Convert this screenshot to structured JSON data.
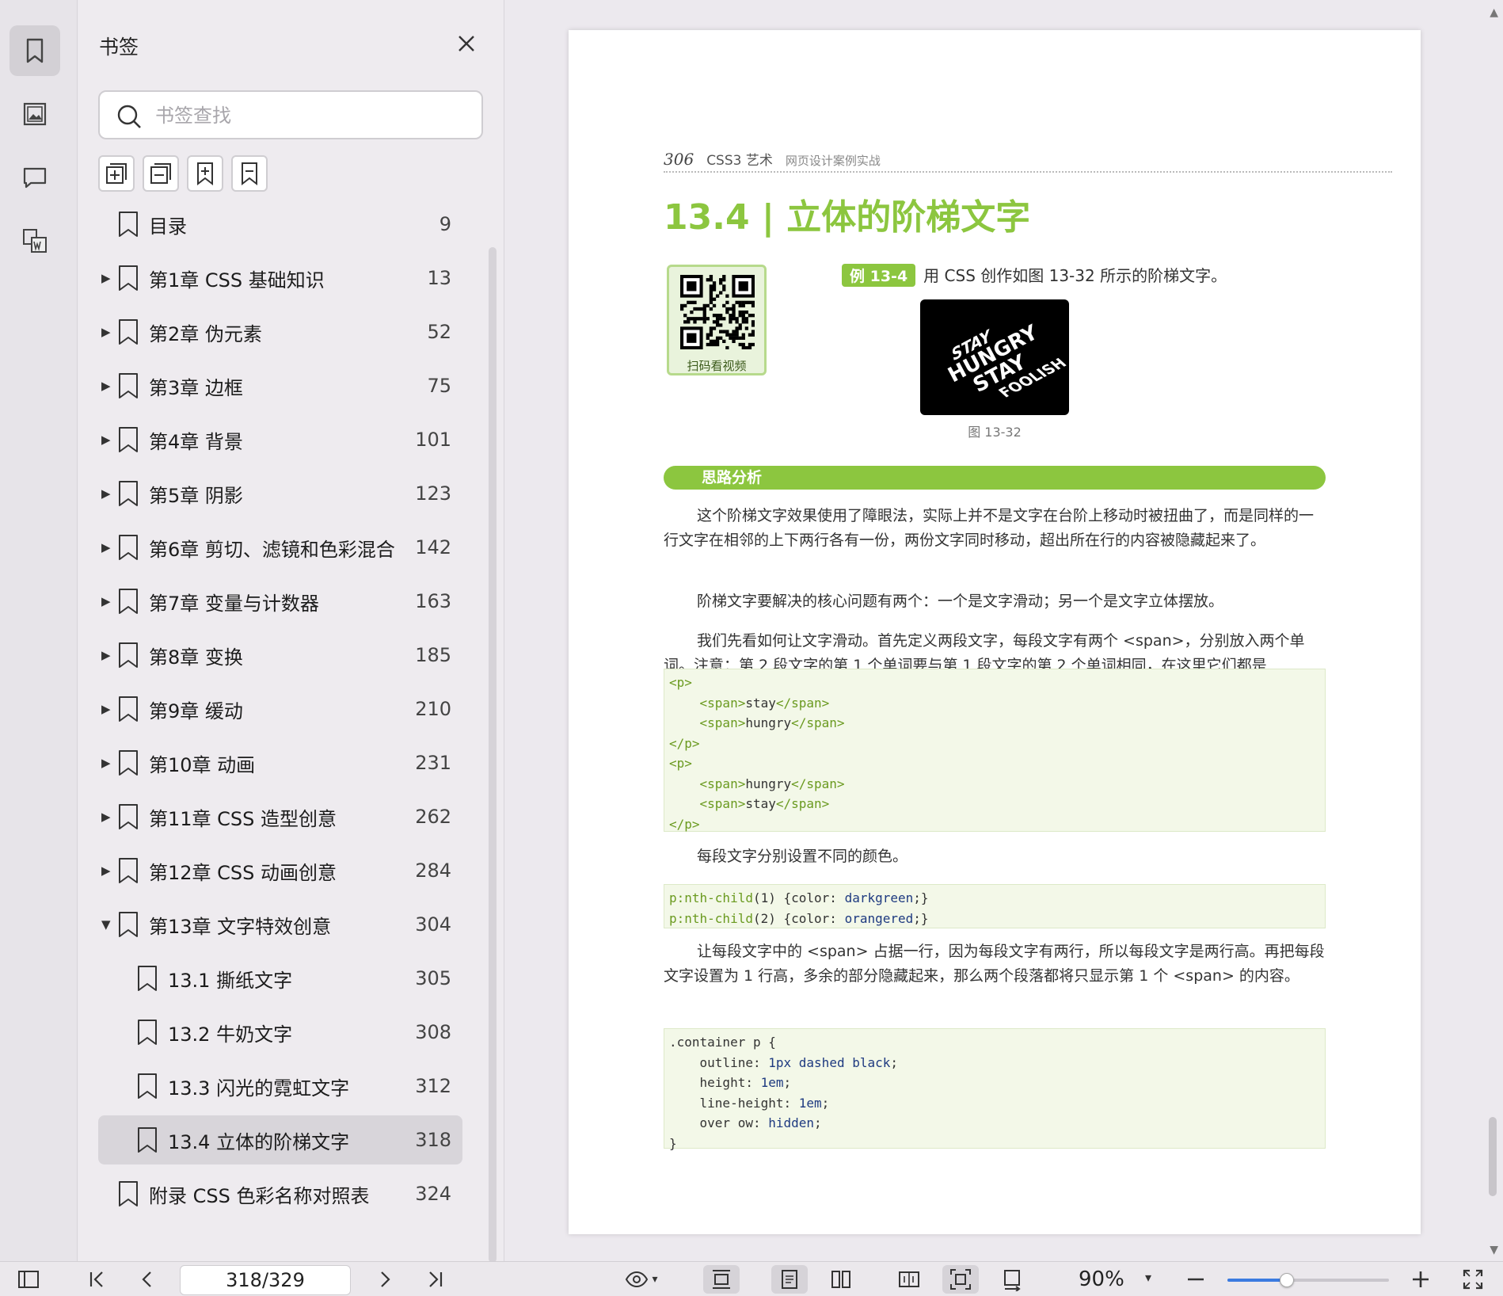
{
  "sidebar": {
    "title": "书签",
    "search_placeholder": "书签查找",
    "items": [
      {
        "label": "目录",
        "page": "9",
        "expandable": false,
        "expanded": false,
        "level": 0,
        "selected": false
      },
      {
        "label": "第1章 CSS 基础知识",
        "page": "13",
        "expandable": true,
        "expanded": false,
        "level": 0,
        "selected": false
      },
      {
        "label": "第2章 伪元素",
        "page": "52",
        "expandable": true,
        "expanded": false,
        "level": 0,
        "selected": false
      },
      {
        "label": "第3章 边框",
        "page": "75",
        "expandable": true,
        "expanded": false,
        "level": 0,
        "selected": false
      },
      {
        "label": "第4章 背景",
        "page": "101",
        "expandable": true,
        "expanded": false,
        "level": 0,
        "selected": false
      },
      {
        "label": "第5章 阴影",
        "page": "123",
        "expandable": true,
        "expanded": false,
        "level": 0,
        "selected": false
      },
      {
        "label": "第6章 剪切、滤镜和色彩混合",
        "page": "142",
        "expandable": true,
        "expanded": false,
        "level": 0,
        "selected": false
      },
      {
        "label": "第7章 变量与计数器",
        "page": "163",
        "expandable": true,
        "expanded": false,
        "level": 0,
        "selected": false
      },
      {
        "label": "第8章 变换",
        "page": "185",
        "expandable": true,
        "expanded": false,
        "level": 0,
        "selected": false
      },
      {
        "label": "第9章 缓动",
        "page": "210",
        "expandable": true,
        "expanded": false,
        "level": 0,
        "selected": false
      },
      {
        "label": "第10章 动画",
        "page": "231",
        "expandable": true,
        "expanded": false,
        "level": 0,
        "selected": false
      },
      {
        "label": "第11章 CSS 造型创意",
        "page": "262",
        "expandable": true,
        "expanded": false,
        "level": 0,
        "selected": false
      },
      {
        "label": "第12章 CSS 动画创意",
        "page": "284",
        "expandable": true,
        "expanded": false,
        "level": 0,
        "selected": false
      },
      {
        "label": "第13章 文字特效创意",
        "page": "304",
        "expandable": true,
        "expanded": true,
        "level": 0,
        "selected": false
      },
      {
        "label": "13.1 撕纸文字",
        "page": "305",
        "expandable": false,
        "expanded": false,
        "level": 1,
        "selected": false
      },
      {
        "label": "13.2 牛奶文字",
        "page": "308",
        "expandable": false,
        "expanded": false,
        "level": 1,
        "selected": false
      },
      {
        "label": "13.3 闪光的霓虹文字",
        "page": "312",
        "expandable": false,
        "expanded": false,
        "level": 1,
        "selected": false
      },
      {
        "label": "13.4 立体的阶梯文字",
        "page": "318",
        "expandable": false,
        "expanded": false,
        "level": 1,
        "selected": true
      },
      {
        "label": "附录 CSS 色彩名称对照表",
        "page": "324",
        "expandable": false,
        "expanded": false,
        "level": 0,
        "selected": false
      }
    ]
  },
  "document": {
    "page_number": "306",
    "book_title": "CSS3 艺术",
    "book_subtitle": "网页设计案例实战",
    "heading": "13.4 | 立体的阶梯文字",
    "qr_label": "扫码看视频",
    "example_badge": "例 13-4",
    "example_text": "用 CSS 创作如图 13-32 所示的阶梯文字。",
    "figure_caption": "图 13-32",
    "figure_words": [
      "STAY",
      "HUNGRY",
      "STAY",
      "FOOLISH"
    ],
    "section_title": "思路分析",
    "para1": "这个阶梯文字效果使用了障眼法，实际上并不是文字在台阶上移动时被扭曲了，而是同样的一行文字在相邻的上下两行各有一份，两份文字同时移动，超出所在行的内容被隐藏起来了。",
    "para2": "阶梯文字要解决的核心问题有两个：一个是文字滑动；另一个是文字立体摆放。",
    "para3": "我们先看如何让文字滑动。首先定义两段文字，每段文字有两个 <span>，分别放入两个单词。注意：第 2 段文字的第 1 个单词要与第 1 段文字的第 2 个单词相同，在这里它们都是 “hungry”。",
    "para4": "每段文字分别设置不同的颜色。",
    "para5": "让每段文字中的 <span> 占据一行，因为每段文字有两行，所以每段文字是两行高。再把每段文字设置为 1 行高，多余的部分隐藏起来，那么两个段落都将只显示第 1 个 <span> 的内容。",
    "code1": [
      "<p>",
      "    <span>stay</span>",
      "    <span>hungry</span>",
      "</p>",
      "<p>",
      "    <span>hungry</span>",
      "    <span>stay</span>",
      "</p>"
    ],
    "code2": [
      "p:nth-child(1) {color: darkgreen;}",
      "p:nth-child(2) {color: orangered;}"
    ],
    "code3": [
      ".container p {",
      "    outline: 1px dashed black;",
      "    height: 1em;",
      "    line-height: 1em;",
      "    over ow: hidden;",
      "}"
    ]
  },
  "toolbar": {
    "page_indicator": "318/329",
    "zoom": "90%",
    "zoom_fraction": 0.37
  },
  "colors": {
    "accent_green": "#8cc63f",
    "selection_gray": "#d8d5da",
    "slider_blue": "#3b7be0"
  }
}
